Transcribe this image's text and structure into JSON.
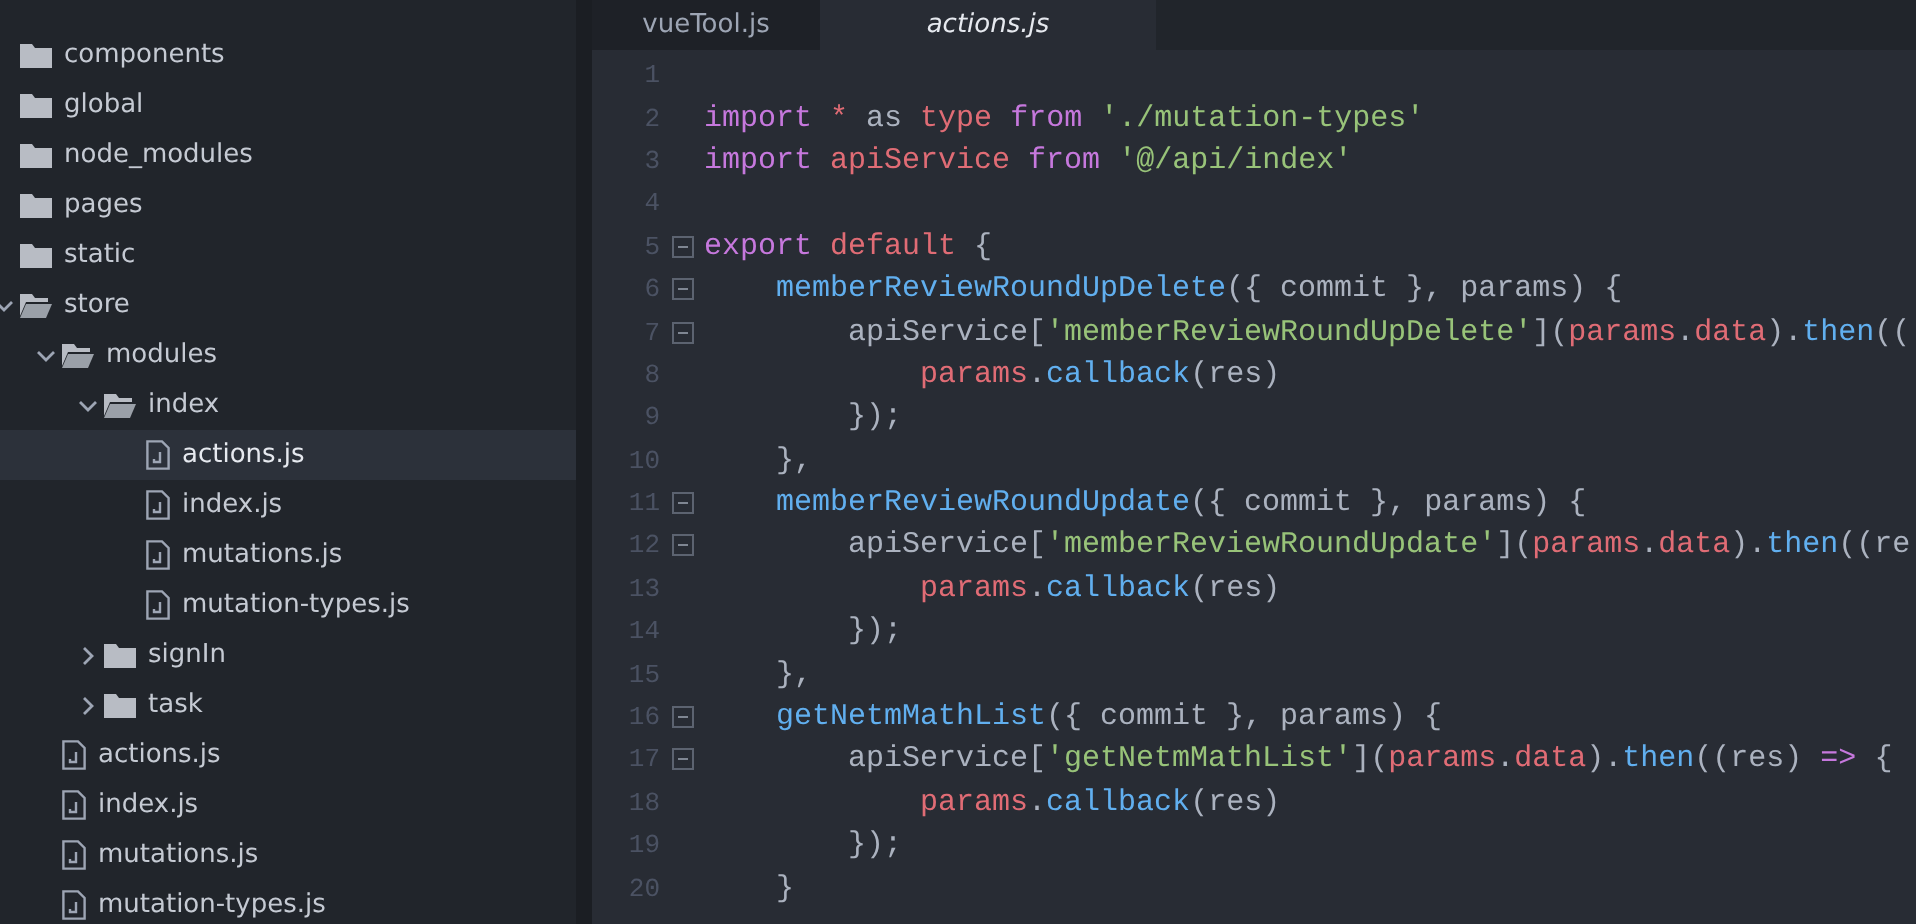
{
  "sidebar": {
    "tree": [
      {
        "kind": "folder",
        "label": "components"
      },
      {
        "kind": "folder",
        "label": "global"
      },
      {
        "kind": "folder",
        "label": "node_modules"
      },
      {
        "kind": "folder",
        "label": "pages"
      },
      {
        "kind": "folder",
        "label": "static"
      },
      {
        "kind": "folder",
        "label": "store",
        "expanded": true,
        "children": [
          {
            "kind": "folder",
            "label": "modules",
            "expanded": true,
            "children": [
              {
                "kind": "folder",
                "label": "index",
                "expanded": true,
                "children": [
                  {
                    "kind": "file",
                    "label": "actions.js",
                    "selected": true
                  },
                  {
                    "kind": "file",
                    "label": "index.js",
                    "selected": false
                  },
                  {
                    "kind": "file",
                    "label": "mutations.js",
                    "selected": false
                  },
                  {
                    "kind": "file",
                    "label": "mutation-types.js",
                    "selected": false
                  }
                ]
              },
              {
                "kind": "folder",
                "label": "signIn",
                "expanded": false
              },
              {
                "kind": "folder",
                "label": "task",
                "expanded": false
              }
            ]
          },
          {
            "kind": "file",
            "label": "actions.js",
            "selected": false
          },
          {
            "kind": "file",
            "label": "index.js",
            "selected": false
          },
          {
            "kind": "file",
            "label": "mutations.js",
            "selected": false
          },
          {
            "kind": "file",
            "label": "mutation-types.js",
            "selected": false
          }
        ]
      }
    ]
  },
  "tabs": [
    {
      "label": "vueTool.js",
      "selected": false
    },
    {
      "label": "actions.js",
      "selected": true
    }
  ],
  "editor": {
    "lines": [
      {
        "number": "1",
        "foldable": false
      },
      {
        "number": "2",
        "foldable": false,
        "tokens": [
          {
            "kind": "keyword",
            "text": "import"
          },
          {
            "kind": "variable",
            "text": " *"
          },
          {
            "kind": "plain",
            "text": " as "
          },
          {
            "kind": "variable",
            "text": "type"
          },
          {
            "kind": "keyword",
            "text": " from"
          },
          {
            "kind": "string",
            "text": " './mutation-types'"
          }
        ]
      },
      {
        "number": "3",
        "foldable": false,
        "tokens": [
          {
            "kind": "keyword",
            "text": "import"
          },
          {
            "kind": "variable",
            "text": " apiService"
          },
          {
            "kind": "keyword",
            "text": " from"
          },
          {
            "kind": "string",
            "text": " '@/api/index'"
          }
        ]
      },
      {
        "number": "4",
        "foldable": false
      },
      {
        "number": "5",
        "foldable": true,
        "tokens": [
          {
            "kind": "keyword",
            "text": "export"
          },
          {
            "kind": "variable",
            "text": " default"
          },
          {
            "kind": "plain",
            "text": " {"
          }
        ]
      },
      {
        "number": "6",
        "foldable": true,
        "tokens": [
          {
            "kind": "function",
            "text": "    memberReviewRoundUpDelete"
          },
          {
            "kind": "plain",
            "text": "({ commit }, params) {"
          }
        ]
      },
      {
        "number": "7",
        "foldable": true,
        "tokens": [
          {
            "kind": "plain",
            "text": "        apiService["
          },
          {
            "kind": "string",
            "text": "'memberReviewRoundUpDelete'"
          },
          {
            "kind": "plain",
            "text": "]("
          },
          {
            "kind": "variable",
            "text": "params"
          },
          {
            "kind": "plain",
            "text": "."
          },
          {
            "kind": "variable",
            "text": "data"
          },
          {
            "kind": "plain",
            "text": ")."
          },
          {
            "kind": "function",
            "text": "then"
          },
          {
            "kind": "plain",
            "text": "(("
          }
        ]
      },
      {
        "number": "8",
        "foldable": false,
        "tokens": [
          {
            "kind": "variable",
            "text": "            params"
          },
          {
            "kind": "plain",
            "text": "."
          },
          {
            "kind": "function",
            "text": "callback"
          },
          {
            "kind": "plain",
            "text": "(res)"
          }
        ]
      },
      {
        "number": "9",
        "foldable": false,
        "tokens": [
          {
            "kind": "plain",
            "text": "        });"
          }
        ]
      },
      {
        "number": "10",
        "foldable": false,
        "tokens": [
          {
            "kind": "plain",
            "text": "    },"
          }
        ]
      },
      {
        "number": "11",
        "foldable": true,
        "tokens": [
          {
            "kind": "function",
            "text": "    memberReviewRoundUpdate"
          },
          {
            "kind": "plain",
            "text": "({ commit }, params) {"
          }
        ]
      },
      {
        "number": "12",
        "foldable": true,
        "tokens": [
          {
            "kind": "plain",
            "text": "        apiService["
          },
          {
            "kind": "string",
            "text": "'memberReviewRoundUpdate'"
          },
          {
            "kind": "plain",
            "text": "]("
          },
          {
            "kind": "variable",
            "text": "params"
          },
          {
            "kind": "plain",
            "text": "."
          },
          {
            "kind": "variable",
            "text": "data"
          },
          {
            "kind": "plain",
            "text": ")."
          },
          {
            "kind": "function",
            "text": "then"
          },
          {
            "kind": "plain",
            "text": "((re"
          }
        ]
      },
      {
        "number": "13",
        "foldable": false,
        "tokens": [
          {
            "kind": "variable",
            "text": "            params"
          },
          {
            "kind": "plain",
            "text": "."
          },
          {
            "kind": "function",
            "text": "callback"
          },
          {
            "kind": "plain",
            "text": "(res)"
          }
        ]
      },
      {
        "number": "14",
        "foldable": false,
        "tokens": [
          {
            "kind": "plain",
            "text": "        });"
          }
        ]
      },
      {
        "number": "15",
        "foldable": false,
        "tokens": [
          {
            "kind": "plain",
            "text": "    },"
          }
        ]
      },
      {
        "number": "16",
        "foldable": true,
        "tokens": [
          {
            "kind": "function",
            "text": "    getNetmMathList"
          },
          {
            "kind": "plain",
            "text": "({ commit }, params) {"
          }
        ]
      },
      {
        "number": "17",
        "foldable": true,
        "tokens": [
          {
            "kind": "plain",
            "text": "        apiService["
          },
          {
            "kind": "string",
            "text": "'getNetmMathList'"
          },
          {
            "kind": "plain",
            "text": "]("
          },
          {
            "kind": "variable",
            "text": "params"
          },
          {
            "kind": "plain",
            "text": "."
          },
          {
            "kind": "variable",
            "text": "data"
          },
          {
            "kind": "plain",
            "text": ")."
          },
          {
            "kind": "function",
            "text": "then"
          },
          {
            "kind": "plain",
            "text": "((res)"
          },
          {
            "kind": "keyword",
            "text": " =>"
          },
          {
            "kind": "plain",
            "text": " {"
          }
        ]
      },
      {
        "number": "18",
        "foldable": false,
        "tokens": [
          {
            "kind": "variable",
            "text": "            params"
          },
          {
            "kind": "plain",
            "text": "."
          },
          {
            "kind": "function",
            "text": "callback"
          },
          {
            "kind": "plain",
            "text": "(res)"
          }
        ]
      },
      {
        "number": "19",
        "foldable": false,
        "tokens": [
          {
            "kind": "plain",
            "text": "        });"
          }
        ]
      },
      {
        "number": "20",
        "foldable": false,
        "tokens": [
          {
            "kind": "plain",
            "text": "    }"
          }
        ]
      }
    ]
  }
}
